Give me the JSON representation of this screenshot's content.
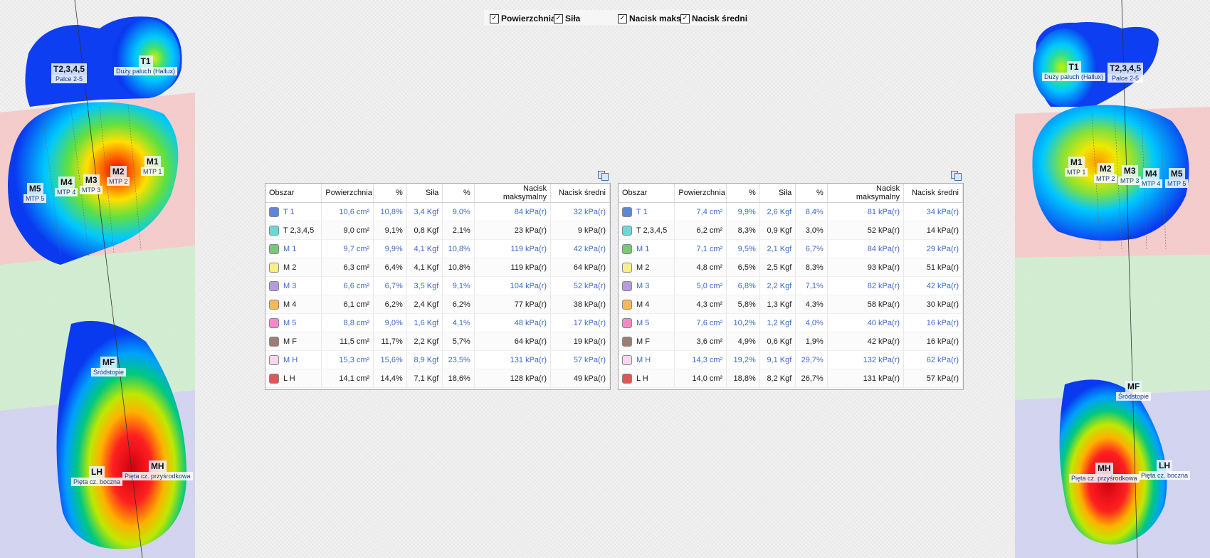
{
  "checkboxes": [
    {
      "label": "Powierzchnia",
      "checked": true,
      "glyph": "✓"
    },
    {
      "label": "Siła",
      "checked": true,
      "glyph": "✓"
    },
    {
      "label": "Nacisk maks",
      "checked": true,
      "glyph": "✓"
    },
    {
      "label": "Nacisk średni",
      "checked": true,
      "glyph": "✓"
    }
  ],
  "columns": [
    "Obszar",
    "Powierzchnia",
    "%",
    "Siła",
    "%",
    "Nacisk maksymalny",
    "Nacisk średni"
  ],
  "left_table": [
    {
      "name": "T 1",
      "color": "#5b87d6",
      "area": "10,6 cm²",
      "area_pct": "10,8%",
      "force": "3,4 Kgf",
      "force_pct": "9,0%",
      "pmax": "84 kPa(r)",
      "pavg": "32 kPa(r)"
    },
    {
      "name": "T 2,3,4,5",
      "color": "#6fd6d8",
      "area": "9,0 cm²",
      "area_pct": "9,1%",
      "force": "0,8 Kgf",
      "force_pct": "2,1%",
      "pmax": "23 kPa(r)",
      "pavg": "9 kPa(r)"
    },
    {
      "name": "M 1",
      "color": "#78c878",
      "area": "9,7 cm²",
      "area_pct": "9,9%",
      "force": "4,1 Kgf",
      "force_pct": "10,8%",
      "pmax": "119 kPa(r)",
      "pavg": "42 kPa(r)"
    },
    {
      "name": "M 2",
      "color": "#f7ef8a",
      "area": "6,3 cm²",
      "area_pct": "6,4%",
      "force": "4,1 Kgf",
      "force_pct": "10,8%",
      "pmax": "119 kPa(r)",
      "pavg": "64 kPa(r)"
    },
    {
      "name": "M 3",
      "color": "#b79be0",
      "area": "6,6 cm²",
      "area_pct": "6,7%",
      "force": "3,5 Kgf",
      "force_pct": "9,1%",
      "pmax": "104 kPa(r)",
      "pavg": "52 kPa(r)"
    },
    {
      "name": "M 4",
      "color": "#f6b95a",
      "area": "6,1 cm²",
      "area_pct": "6,2%",
      "force": "2,4 Kgf",
      "force_pct": "6,2%",
      "pmax": "77 kPa(r)",
      "pavg": "38 kPa(r)"
    },
    {
      "name": "M 5",
      "color": "#f28ac8",
      "area": "8,8 cm²",
      "area_pct": "9,0%",
      "force": "1,6 Kgf",
      "force_pct": "4,1%",
      "pmax": "48 kPa(r)",
      "pavg": "17 kPa(r)"
    },
    {
      "name": "M F",
      "color": "#9c7f74",
      "area": "11,5 cm²",
      "area_pct": "11,7%",
      "force": "2,2 Kgf",
      "force_pct": "5,7%",
      "pmax": "64 kPa(r)",
      "pavg": "19 kPa(r)"
    },
    {
      "name": "M H",
      "color": "#f7d6f0",
      "area": "15,3 cm²",
      "area_pct": "15,6%",
      "force": "8,9 Kgf",
      "force_pct": "23,5%",
      "pmax": "131 kPa(r)",
      "pavg": "57 kPa(r)"
    },
    {
      "name": "L H",
      "color": "#e05555",
      "area": "14,1 cm²",
      "area_pct": "14,4%",
      "force": "7,1 Kgf",
      "force_pct": "18,6%",
      "pmax": "128 kPa(r)",
      "pavg": "49 kPa(r)"
    }
  ],
  "right_table": [
    {
      "name": "T 1",
      "color": "#5b87d6",
      "area": "7,4 cm²",
      "area_pct": "9,9%",
      "force": "2,6 Kgf",
      "force_pct": "8,4%",
      "pmax": "81 kPa(r)",
      "pavg": "34 kPa(r)"
    },
    {
      "name": "T 2,3,4,5",
      "color": "#6fd6d8",
      "area": "6,2 cm²",
      "area_pct": "8,3%",
      "force": "0,9 Kgf",
      "force_pct": "3,0%",
      "pmax": "52 kPa(r)",
      "pavg": "14 kPa(r)"
    },
    {
      "name": "M 1",
      "color": "#78c878",
      "area": "7,1 cm²",
      "area_pct": "9,5%",
      "force": "2,1 Kgf",
      "force_pct": "6,7%",
      "pmax": "84 kPa(r)",
      "pavg": "29 kPa(r)"
    },
    {
      "name": "M 2",
      "color": "#f7ef8a",
      "area": "4,8 cm²",
      "area_pct": "6,5%",
      "force": "2,5 Kgf",
      "force_pct": "8,3%",
      "pmax": "93 kPa(r)",
      "pavg": "51 kPa(r)"
    },
    {
      "name": "M 3",
      "color": "#b79be0",
      "area": "5,0 cm²",
      "area_pct": "6,8%",
      "force": "2,2 Kgf",
      "force_pct": "7,1%",
      "pmax": "82 kPa(r)",
      "pavg": "42 kPa(r)"
    },
    {
      "name": "M 4",
      "color": "#f6b95a",
      "area": "4,3 cm²",
      "area_pct": "5,8%",
      "force": "1,3 Kgf",
      "force_pct": "4,3%",
      "pmax": "58 kPa(r)",
      "pavg": "30 kPa(r)"
    },
    {
      "name": "M 5",
      "color": "#f28ac8",
      "area": "7,6 cm²",
      "area_pct": "10,2%",
      "force": "1,2 Kgf",
      "force_pct": "4,0%",
      "pmax": "40 kPa(r)",
      "pavg": "16 kPa(r)"
    },
    {
      "name": "M F",
      "color": "#9c7f74",
      "area": "3,6 cm²",
      "area_pct": "4,9%",
      "force": "0,6 Kgf",
      "force_pct": "1,9%",
      "pmax": "42 kPa(r)",
      "pavg": "16 kPa(r)"
    },
    {
      "name": "M H",
      "color": "#f7d6f0",
      "area": "14,3 cm²",
      "area_pct": "19,2%",
      "force": "9,1 Kgf",
      "force_pct": "29,7%",
      "pmax": "132 kPa(r)",
      "pavg": "62 kPa(r)"
    },
    {
      "name": "L H",
      "color": "#e05555",
      "area": "14,0 cm²",
      "area_pct": "18,8%",
      "force": "8,2 Kgf",
      "force_pct": "26,7%",
      "pmax": "131 kPa(r)",
      "pavg": "57 kPa(r)"
    }
  ],
  "left_foot_labels": [
    {
      "code": "T2,3,4,5",
      "desc": "Palce 2-5"
    },
    {
      "code": "T1",
      "desc": "Duży paluch (Hallux)"
    },
    {
      "code": "M1",
      "desc": "MTP 1"
    },
    {
      "code": "M2",
      "desc": "MTP 2"
    },
    {
      "code": "M3",
      "desc": "MTP 3"
    },
    {
      "code": "M4",
      "desc": "MTP 4"
    },
    {
      "code": "M5",
      "desc": "MTP 5"
    },
    {
      "code": "MF",
      "desc": "Śródstopie"
    },
    {
      "code": "LH",
      "desc": "Pięta cz. boczna"
    },
    {
      "code": "MH",
      "desc": "Pięta cz. przyśrodkowa"
    }
  ],
  "right_foot_labels": [
    {
      "code": "T1",
      "desc": "Duży paluch (Hallux)"
    },
    {
      "code": "T2,3,4,5",
      "desc": "Palce 2-5"
    },
    {
      "code": "M1",
      "desc": "MTP 1"
    },
    {
      "code": "M2",
      "desc": "MTP 2"
    },
    {
      "code": "M3",
      "desc": "MTP 3"
    },
    {
      "code": "M4",
      "desc": "MTP 4"
    },
    {
      "code": "M5",
      "desc": "MTP 5"
    },
    {
      "code": "MF",
      "desc": "Śródstopie"
    },
    {
      "code": "MH",
      "desc": "Pięta cz. przyśrodkowa"
    },
    {
      "code": "LH",
      "desc": "Pięta cz. boczna"
    }
  ]
}
